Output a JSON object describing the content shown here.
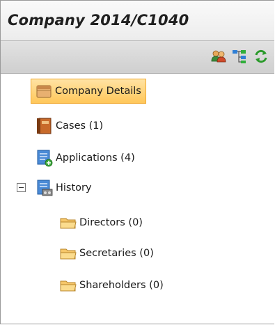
{
  "panel": {
    "title": "Company 2014/C1040"
  },
  "toolbar": {
    "buttons": [
      {
        "icon": "people-icon"
      },
      {
        "icon": "tree-structure-icon"
      },
      {
        "icon": "refresh-icon"
      }
    ]
  },
  "tree": {
    "items": [
      {
        "label": "Company Details",
        "icon": "folder-open-icon",
        "selected": true
      },
      {
        "label": "Cases (1)",
        "icon": "case-book-icon"
      },
      {
        "label": "Applications (4)",
        "icon": "application-add-icon"
      },
      {
        "label": "History",
        "icon": "history-icon",
        "expanded": true
      },
      {
        "label": "Directors (0)",
        "icon": "folder-icon"
      },
      {
        "label": "Secretaries (0)",
        "icon": "folder-icon"
      },
      {
        "label": "Shareholders (0)",
        "icon": "folder-icon"
      }
    ]
  },
  "colors": {
    "selected_bg": "#ffc75a",
    "selected_border": "#f0a830",
    "folder": "#f6c76a"
  }
}
